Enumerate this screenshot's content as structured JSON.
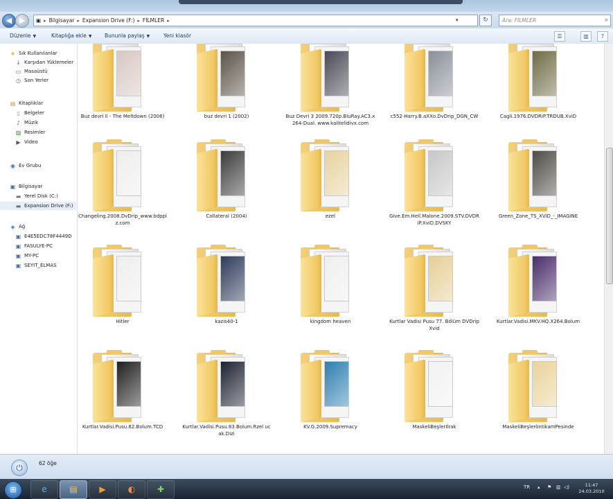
{
  "address": {
    "crumbs": [
      "Bilgisayar",
      "Expansion Drive (F:)",
      "FİLMLER"
    ],
    "search_placeholder": "Ara: FİLMLER"
  },
  "toolbar": {
    "organize": "Düzenle",
    "add_to_library": "Kitaplığa ekle",
    "share_with": "Bununla paylaş",
    "new_folder": "Yeni klasör"
  },
  "sidebar": {
    "favorites": {
      "title": "Sık Kullanılanlar",
      "items": [
        "Karşıdan Yüklemeler",
        "Masaüstü",
        "Son Yerler"
      ]
    },
    "libraries": {
      "title": "Kitaplıklar",
      "items": [
        "Belgeler",
        "Müzik",
        "Resimler",
        "Video"
      ]
    },
    "homegroup": "Ev Grubu",
    "computer": {
      "title": "Bilgisayar",
      "items": [
        "Yerel Disk (C:)",
        "Expansion Drive (F:)"
      ]
    },
    "network": {
      "title": "Ağ",
      "items": [
        "E4E5EDC78F4449D",
        "FASULYE-PC",
        "MY-PC",
        "SEYIT_ELMAS"
      ]
    }
  },
  "folders": [
    {
      "name": "Buz devri ll - The Meltdown (2006)",
      "thumb": "#d7c8c2"
    },
    {
      "name": "buz devri 1 (2002)",
      "thumb": "#5c5248"
    },
    {
      "name": "Buz Devri 3 2009.720p.BluRay.AC3.x264-Dual. www.kalitelidivx.com",
      "thumb": "#4a4a58"
    },
    {
      "name": "c552-Harry.B.aXXo.DvDrip_DGN_CW",
      "thumb": "#8a8f99"
    },
    {
      "name": "Cagli.1976.DVDRiP.TRDUB.XviD",
      "thumb": "#6f6b44"
    },
    {
      "name": "Changeling.2008.DvDrip_www.bdpplz.com",
      "thumb": "#eeeeee"
    },
    {
      "name": "Collateral (2004)",
      "thumb": "#3c3c3c"
    },
    {
      "name": "ezel",
      "thumb": "#e8d3a0"
    },
    {
      "name": "Give.Em.Hell.Malone.2009.STV.DVDRiP.XviD.DVSKY",
      "thumb": "#c7c7c7"
    },
    {
      "name": "Green_Zone_TS_XViD_-_IMAGiNE",
      "thumb": "#4d4b46"
    },
    {
      "name": "Hitler",
      "thumb": "#eeeeee"
    },
    {
      "name": "kazis40-1",
      "thumb": "#2d3a5a"
    },
    {
      "name": "kingdom heaven",
      "thumb": "#efefef"
    },
    {
      "name": "Kurtlar Vadisi Pusu 77. Bölüm DVDrip Xvid",
      "thumb": "#e6cf96"
    },
    {
      "name": "Kurtlar.Vadisi.MKV.HQ.X264.Bolum",
      "thumb": "#4a2d6a"
    },
    {
      "name": "Kurtlar.Vadisi.Pusu.82.Bolum.TCD",
      "thumb": "#202020"
    },
    {
      "name": "Kurtlar.Vadisi.Pusu.83.Bolum.Rzel ucak.Dizi",
      "thumb": "#1c2230"
    },
    {
      "name": "KV.G.2009.Supremacy",
      "thumb": "#2e7fb0"
    },
    {
      "name": "MaskeliBeşlerIlrak",
      "thumb": "#f2f2f2"
    },
    {
      "name": "MaskeliBeşleröntikamPesinde",
      "thumb": "#e9d39a"
    }
  ],
  "status": {
    "count": "62 öğe"
  },
  "taskbar": {
    "lang": "TR",
    "time": "11:47",
    "date": "24.03.2010"
  }
}
